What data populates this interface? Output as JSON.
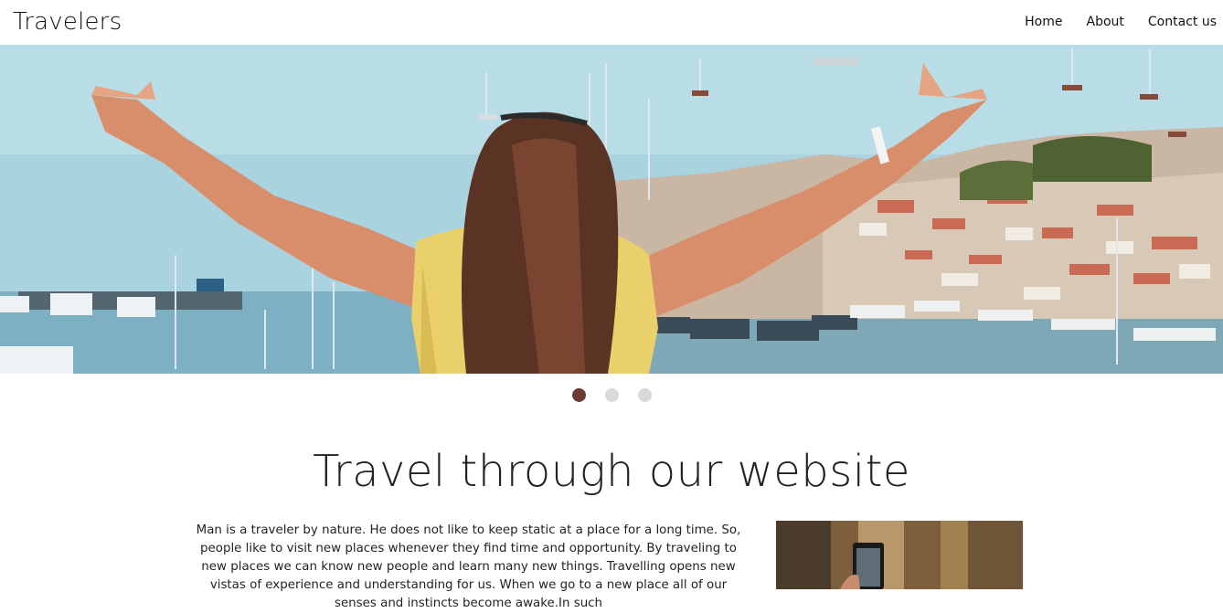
{
  "header": {
    "brand": "Travelers",
    "nav": [
      {
        "label": "Home"
      },
      {
        "label": "About"
      },
      {
        "label": "Contact us"
      }
    ]
  },
  "carousel": {
    "slide_count": 3,
    "active_index": 0,
    "colors": {
      "active": "#6b3a32",
      "inactive": "#d9d9d9"
    }
  },
  "main": {
    "title": "Travel through our website",
    "paragraph": "Man is a traveler by nature. He does not like to keep static at a place for a long time. So, people like to visit new places whenever they find time and opportunity. By traveling to new places we can know new people and learn many new things. Travelling opens new vistas of experience and understanding for us. When we go to a new place all of our senses and instincts become awake.In such"
  }
}
